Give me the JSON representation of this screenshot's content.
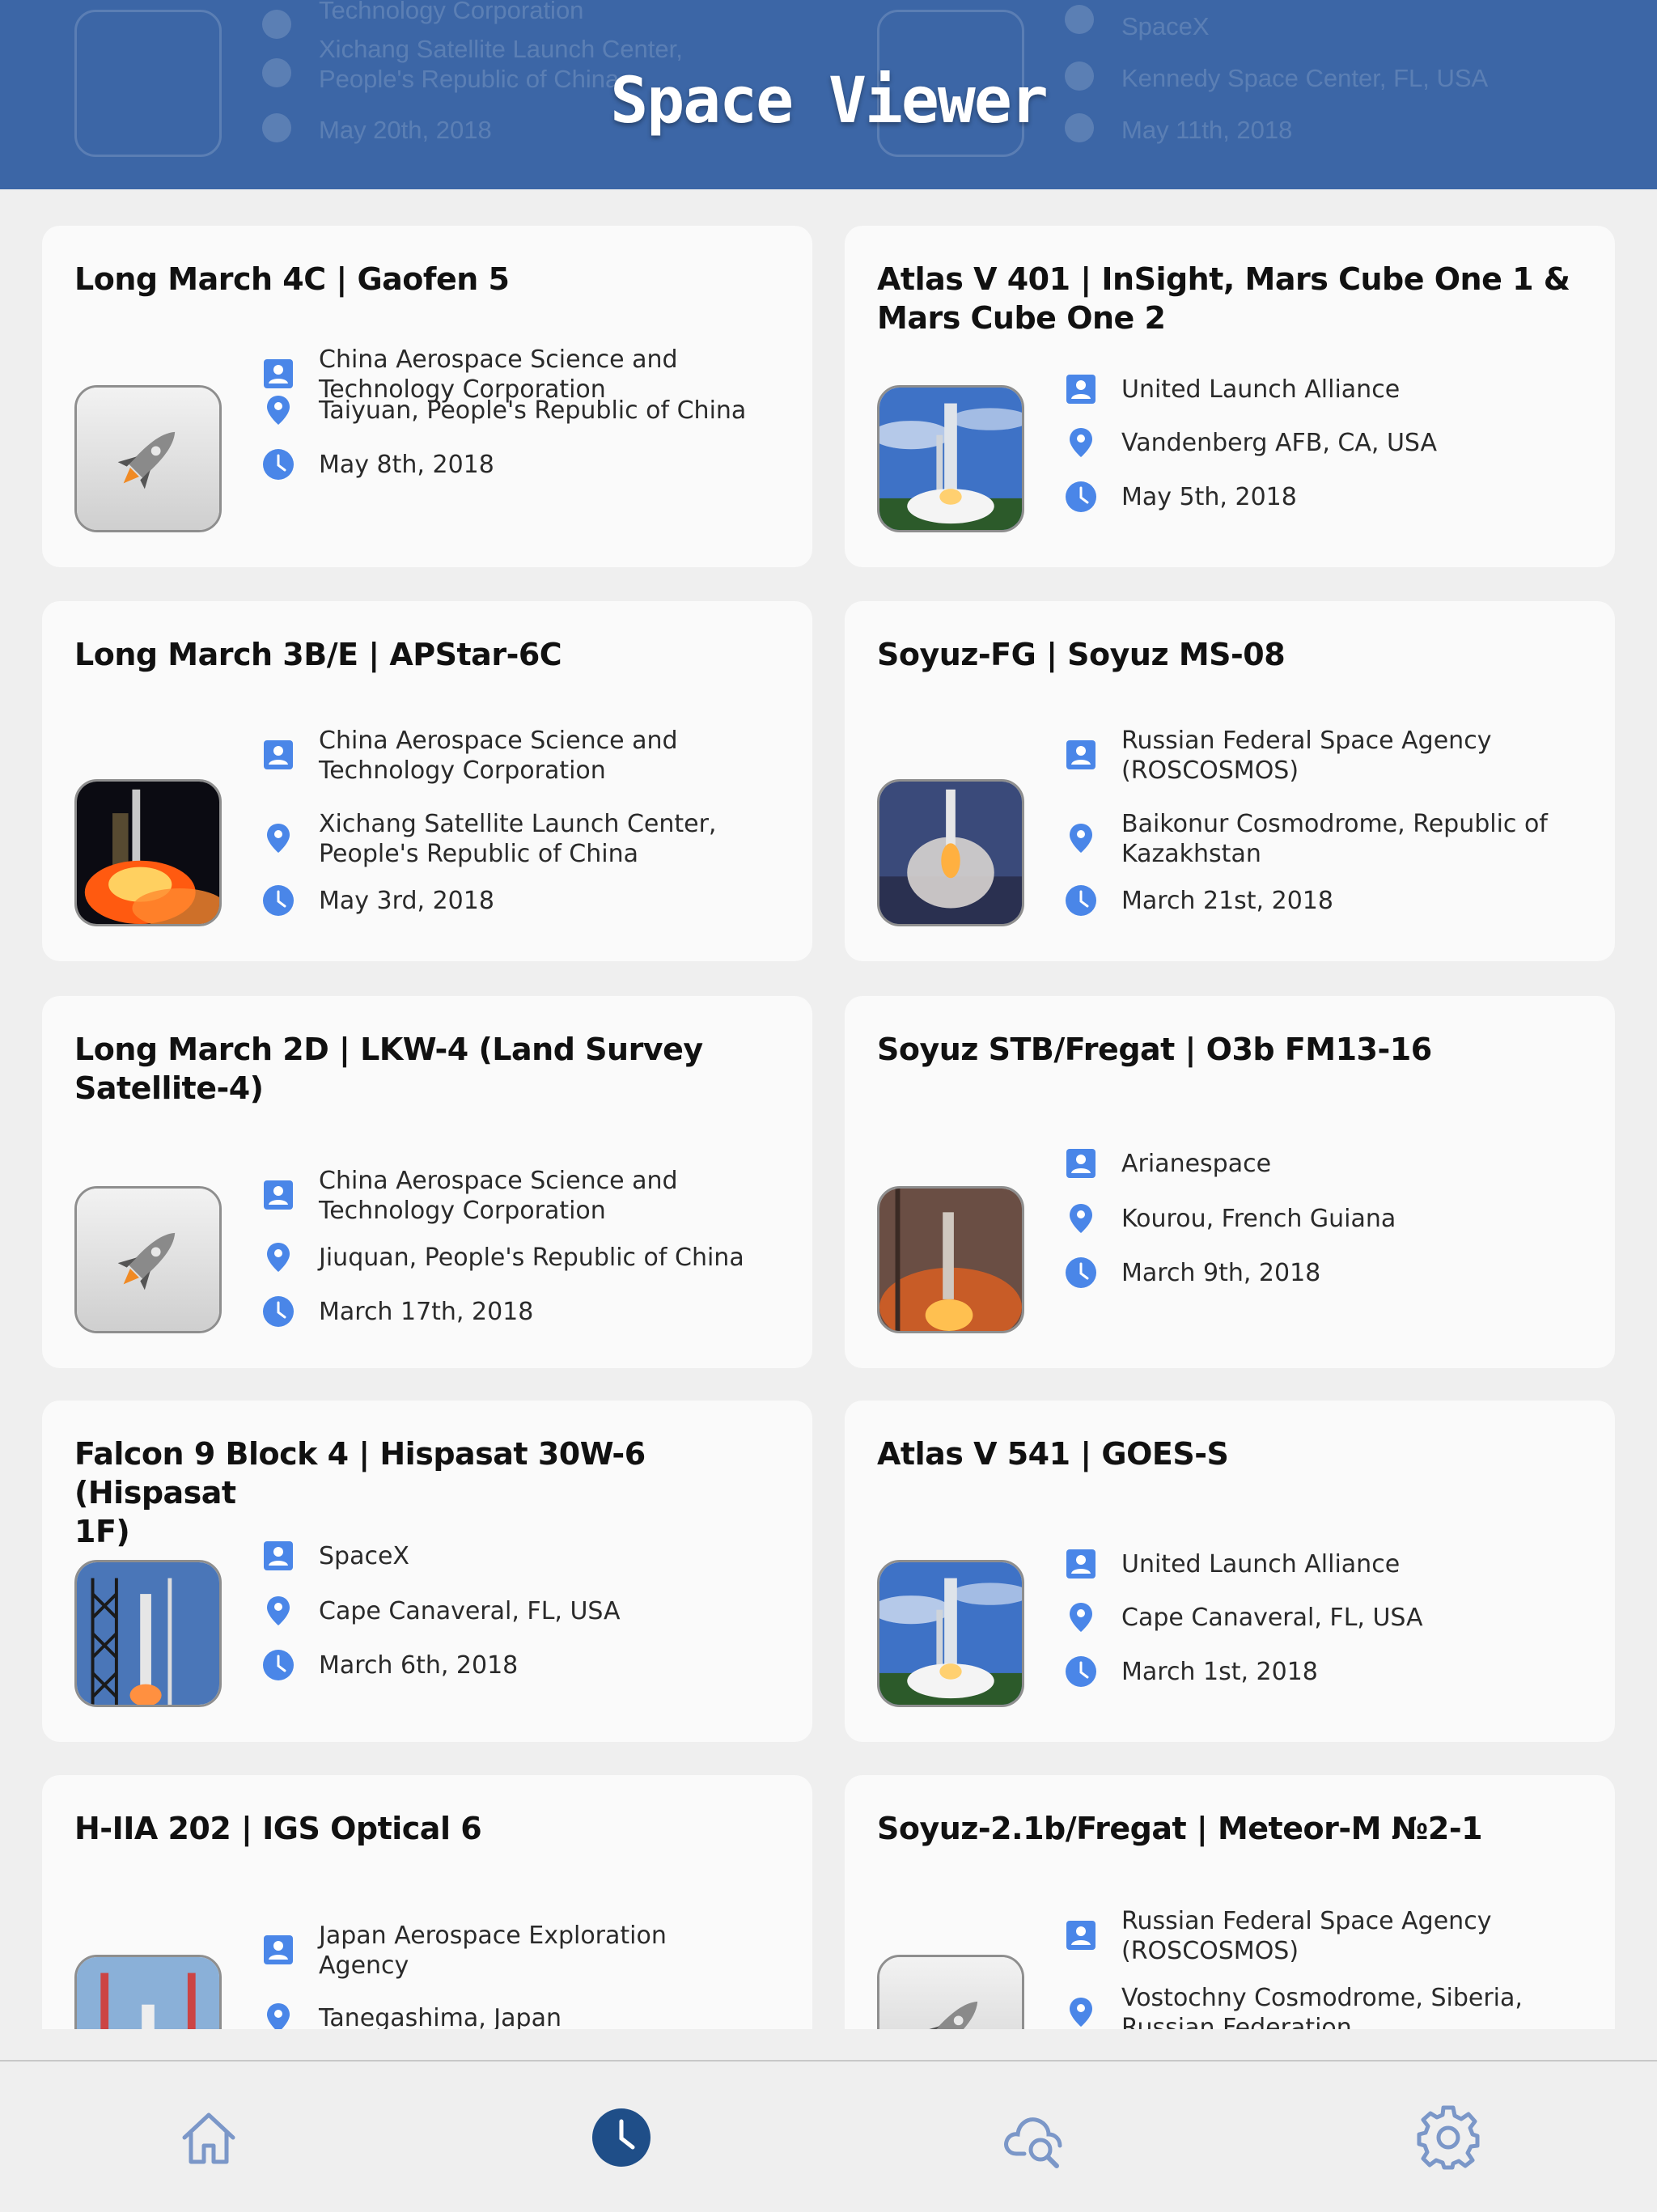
{
  "app": {
    "title": "Space Viewer"
  },
  "header_ghost": [
    {
      "line1": "Technology Corporation",
      "line2": "Xichang Satellite Launch Center,\nPeople's Republic of China",
      "line3": "May 20th, 2018"
    },
    {
      "line1": "SpaceX",
      "line2": "Kennedy Space Center, FL, USA",
      "line3": "May 11th, 2018"
    }
  ],
  "launches": [
    {
      "title": "Long March 4C | Gaofen 5",
      "agency": "China Aerospace Science and\nTechnology Corporation",
      "location": "Taiyuan, People's Republic of China",
      "date": "May 8th, 2018",
      "image": "rocket-placeholder"
    },
    {
      "title": "Atlas V 401 | InSight, Mars Cube One 1 &\nMars Cube One 2",
      "agency": "United Launch Alliance",
      "location": "Vandenberg AFB, CA, USA",
      "date": "May 5th, 2018",
      "image": "launch-day"
    },
    {
      "title": "Long March 3B/E | APStar-6C",
      "agency": "China Aerospace Science and\nTechnology Corporation",
      "location": "Xichang Satellite Launch Center,\nPeople's Republic of China",
      "date": "May 3rd, 2018",
      "image": "launch-night"
    },
    {
      "title": "Soyuz-FG | Soyuz MS-08",
      "agency": "Russian Federal Space Agency\n(ROSCOSMOS)",
      "location": "Baikonur Cosmodrome, Republic of\nKazakhstan",
      "date": "March 21st, 2018",
      "image": "launch-dusk"
    },
    {
      "title": "Long March 2D | LKW-4 (Land Survey\nSatellite-4)",
      "agency": "China Aerospace Science and\nTechnology Corporation",
      "location": "Jiuquan, People's Republic of China",
      "date": "March 17th, 2018",
      "image": "rocket-placeholder"
    },
    {
      "title": "Soyuz STB/Fregat | O3b FM13-16",
      "agency": "Arianespace",
      "location": "Kourou, French Guiana",
      "date": "March 9th, 2018",
      "image": "launch-smoke"
    },
    {
      "title": "Falcon 9 Block 4 | Hispasat 30W-6 (Hispasat\n1F)",
      "agency": "SpaceX",
      "location": "Cape Canaveral, FL, USA",
      "date": "March 6th, 2018",
      "image": "launch-tower"
    },
    {
      "title": "Atlas V 541 | GOES-S",
      "agency": "United Launch Alliance",
      "location": "Cape Canaveral, FL, USA",
      "date": "March 1st, 2018",
      "image": "launch-day"
    },
    {
      "title": "H-IIA 202 | IGS Optical 6",
      "agency": "Japan Aerospace Exploration\nAgency",
      "location": "Tanegashima, Japan",
      "date": "",
      "image": "launch-pad"
    },
    {
      "title": "Soyuz-2.1b/Fregat | Meteor-M №2-1",
      "agency": "Russian Federal Space Agency\n(ROSCOSMOS)",
      "location": "Vostochny Cosmodrome, Siberia,\nRussian Federation",
      "date": "",
      "image": "rocket-placeholder"
    }
  ],
  "tabs": [
    {
      "name": "home",
      "icon": "home-icon",
      "active": false
    },
    {
      "name": "launches",
      "icon": "clock-icon",
      "active": true
    },
    {
      "name": "search",
      "icon": "cloud-search-icon",
      "active": false
    },
    {
      "name": "settings",
      "icon": "gear-icon",
      "active": false
    }
  ],
  "colors": {
    "header": "#3c66a6",
    "accent": "#4a86e8",
    "tab_inactive": "#7b97c8",
    "tab_active": "#1f4e88"
  }
}
